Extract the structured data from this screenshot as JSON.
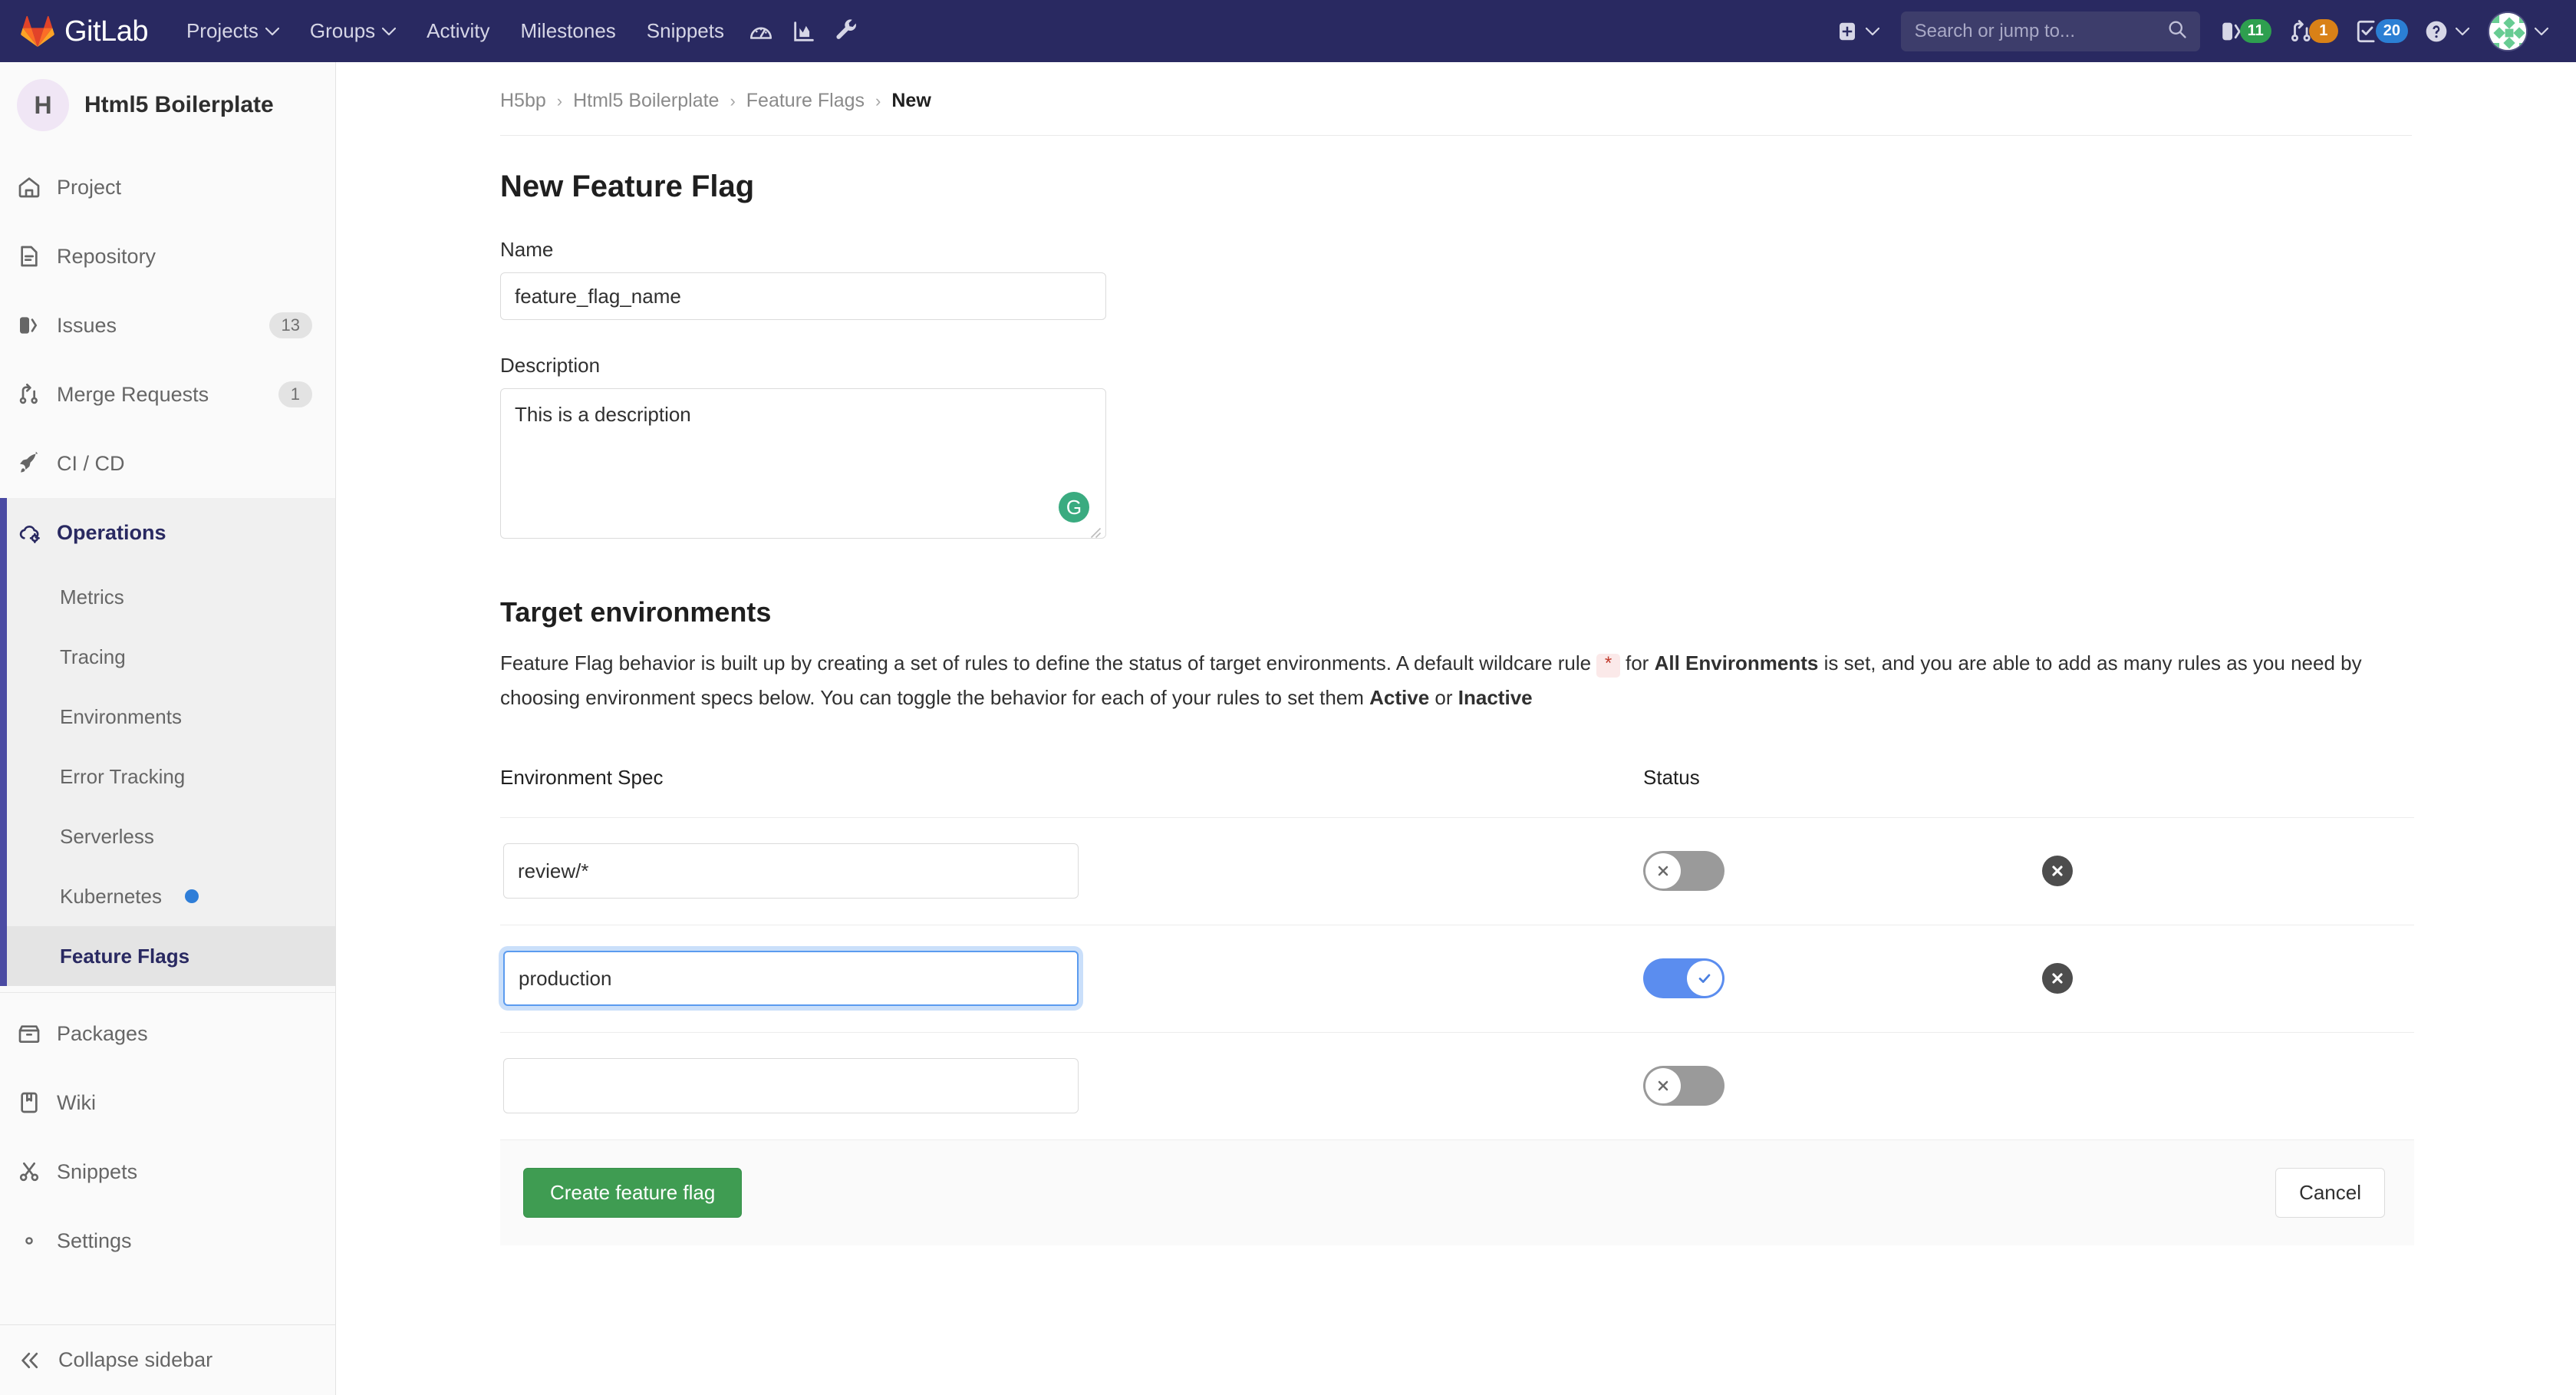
{
  "navbar": {
    "brand": "GitLab",
    "links": [
      {
        "label": "Projects",
        "has_caret": true
      },
      {
        "label": "Groups",
        "has_caret": true
      },
      {
        "label": "Activity",
        "has_caret": false
      },
      {
        "label": "Milestones",
        "has_caret": false
      },
      {
        "label": "Snippets",
        "has_caret": false
      }
    ],
    "icons": [
      "dashboard-icon",
      "analytics-icon",
      "wrench-icon"
    ],
    "search": {
      "placeholder": "Search or jump to...",
      "value": ""
    },
    "counters": [
      {
        "name": "issues",
        "count": "11",
        "color": "#2e9f4f"
      },
      {
        "name": "merge-requests",
        "count": "1",
        "color": "#d98117"
      },
      {
        "name": "todos",
        "count": "20",
        "color": "#2b7fd4"
      }
    ],
    "new_label": "New...",
    "help_label": "Help",
    "user_label": "User menu"
  },
  "sidebar": {
    "project": {
      "initial": "H",
      "name": "Html5 Boilerplate"
    },
    "items": [
      {
        "label": "Project",
        "icon": "home-icon",
        "count": ""
      },
      {
        "label": "Repository",
        "icon": "doc-icon",
        "count": ""
      },
      {
        "label": "Issues",
        "icon": "issues-icon",
        "count": "13"
      },
      {
        "label": "Merge Requests",
        "icon": "merge-icon",
        "count": "1"
      },
      {
        "label": "CI / CD",
        "icon": "rocket-icon",
        "count": ""
      },
      {
        "label": "Operations",
        "icon": "cloud-gear-icon",
        "count": "",
        "active": true
      }
    ],
    "sub_items": [
      {
        "label": "Metrics"
      },
      {
        "label": "Tracing"
      },
      {
        "label": "Environments"
      },
      {
        "label": "Error Tracking"
      },
      {
        "label": "Serverless"
      },
      {
        "label": "Kubernetes",
        "dot": true
      },
      {
        "label": "Feature Flags",
        "active": true
      }
    ],
    "items_after": [
      {
        "label": "Packages",
        "icon": "package-icon",
        "count": ""
      },
      {
        "label": "Wiki",
        "icon": "wiki-icon",
        "count": ""
      },
      {
        "label": "Snippets",
        "icon": "snippet-icon",
        "count": ""
      },
      {
        "label": "Settings",
        "icon": "gear-icon",
        "count": ""
      }
    ],
    "collapse_label": "Collapse sidebar"
  },
  "breadcrumb": {
    "items": [
      "H5bp",
      "Html5 Boilerplate",
      "Feature Flags"
    ],
    "current": "New",
    "separator": "›"
  },
  "page": {
    "title": "New Feature Flag",
    "name_label": "Name",
    "name_value": "feature_flag_name",
    "name_placeholder": "",
    "description_label": "Description",
    "description_value": "This is a description",
    "description_placeholder": "",
    "grammarly_glyph": "G"
  },
  "target": {
    "title": "Target environments",
    "desc_part1": "Feature Flag behavior is built up by creating a set of rules to define the status of target environments. A default wildcare rule ",
    "desc_code": "*",
    "desc_part2": " for ",
    "desc_bold1": "All Environments",
    "desc_part3": " is set, and you are able to add as many rules as you need by choosing environment specs below. You can toggle the behavior for each of your rules to set them ",
    "desc_bold2": "Active",
    "desc_part4": " or ",
    "desc_bold3": "Inactive",
    "col_spec": "Environment Spec",
    "col_status": "Status",
    "rows": [
      {
        "spec": "review/*",
        "placeholder": "",
        "status": "off",
        "focused": false,
        "removable": true
      },
      {
        "spec": "production",
        "placeholder": "",
        "status": "on",
        "focused": true,
        "removable": true
      },
      {
        "spec": "",
        "placeholder": "",
        "status": "off",
        "focused": false,
        "removable": false
      }
    ]
  },
  "actions": {
    "submit_label": "Create feature flag",
    "cancel_label": "Cancel"
  },
  "colors": {
    "navbar_bg": "#292961",
    "accent": "#4b4ba3",
    "primary_button": "#3f9c52",
    "toggle_on": "#5b8def",
    "toggle_off": "#9a9a9a",
    "code_red": "#c0392b"
  }
}
